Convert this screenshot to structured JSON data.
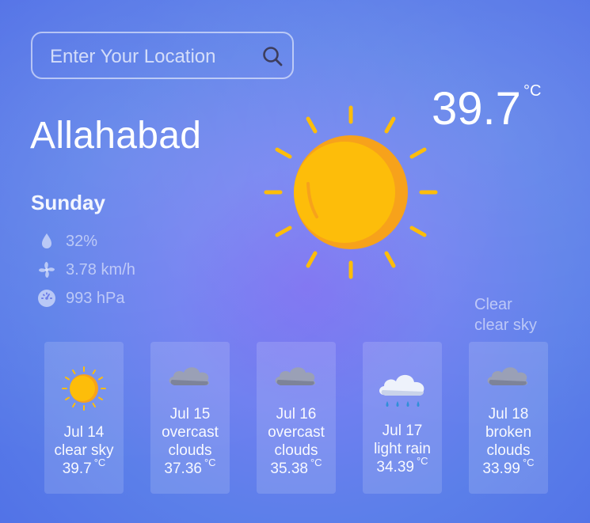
{
  "search": {
    "placeholder": "Enter Your Location",
    "icon": "search-icon"
  },
  "current": {
    "city": "Allahabad",
    "temperature": "39.7",
    "unit": "°C",
    "day": "Sunday",
    "humidity": "32%",
    "wind": "3.78 km/h",
    "pressure": "993 hPa",
    "condition_main": "Clear",
    "condition_desc": "clear sky",
    "icon": "sun-icon"
  },
  "forecast": [
    {
      "date": "Jul 14",
      "desc": "clear sky",
      "temp": "39.7",
      "unit": "°C",
      "icon": "sun-icon"
    },
    {
      "date": "Jul 15",
      "desc": "overcast clouds",
      "temp": "37.36",
      "unit": "°C",
      "icon": "cloud-icon"
    },
    {
      "date": "Jul 16",
      "desc": "overcast clouds",
      "temp": "35.38",
      "unit": "°C",
      "icon": "cloud-icon"
    },
    {
      "date": "Jul 17",
      "desc": "light rain",
      "temp": "34.39",
      "unit": "°C",
      "icon": "rain-icon"
    },
    {
      "date": "Jul 18",
      "desc": "broken clouds",
      "temp": "33.99",
      "unit": "°C",
      "icon": "cloud-icon"
    }
  ],
  "colors": {
    "sun": "#fdbd0a",
    "sun_shade": "#f7a21b",
    "accent_bg": "#6f7ff0"
  }
}
